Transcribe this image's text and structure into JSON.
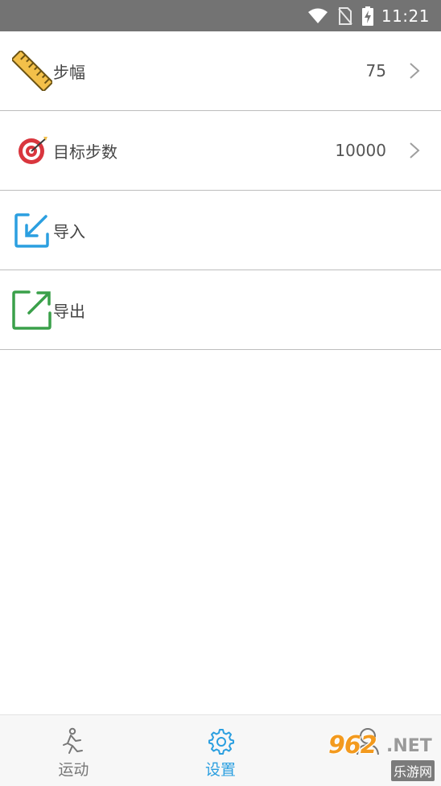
{
  "status_bar": {
    "time": "11:21",
    "icons": [
      "wifi-icon",
      "no-sim-icon",
      "battery-charging-icon"
    ]
  },
  "settings": {
    "items": [
      {
        "label": "步幅",
        "value": "75",
        "icon": "ruler-icon",
        "has_chevron": true
      },
      {
        "label": "目标步数",
        "value": "10000",
        "icon": "target-icon",
        "has_chevron": true
      },
      {
        "label": "导入",
        "value": "",
        "icon": "import-icon",
        "has_chevron": false
      },
      {
        "label": "导出",
        "value": "",
        "icon": "export-icon",
        "has_chevron": false
      }
    ]
  },
  "bottom_nav": {
    "items": [
      {
        "label": "运动",
        "icon": "running-person-icon",
        "active": false
      },
      {
        "label": "设置",
        "icon": "gear-icon",
        "active": true
      },
      {
        "label": "",
        "icon": "person-icon",
        "active": false
      }
    ]
  },
  "watermark": {
    "brand": "962",
    "suffix": ".NET",
    "sub": "乐游网"
  },
  "colors": {
    "status_bar_bg": "#737373",
    "divider": "#bdbdbd",
    "accent": "#2b9fe0",
    "import_icon": "#2b9fe0",
    "export_icon": "#3aa04a",
    "target_red": "#d9363e",
    "ruler_yellow": "#f3c04a",
    "watermark_orange": "#f39a1e"
  }
}
